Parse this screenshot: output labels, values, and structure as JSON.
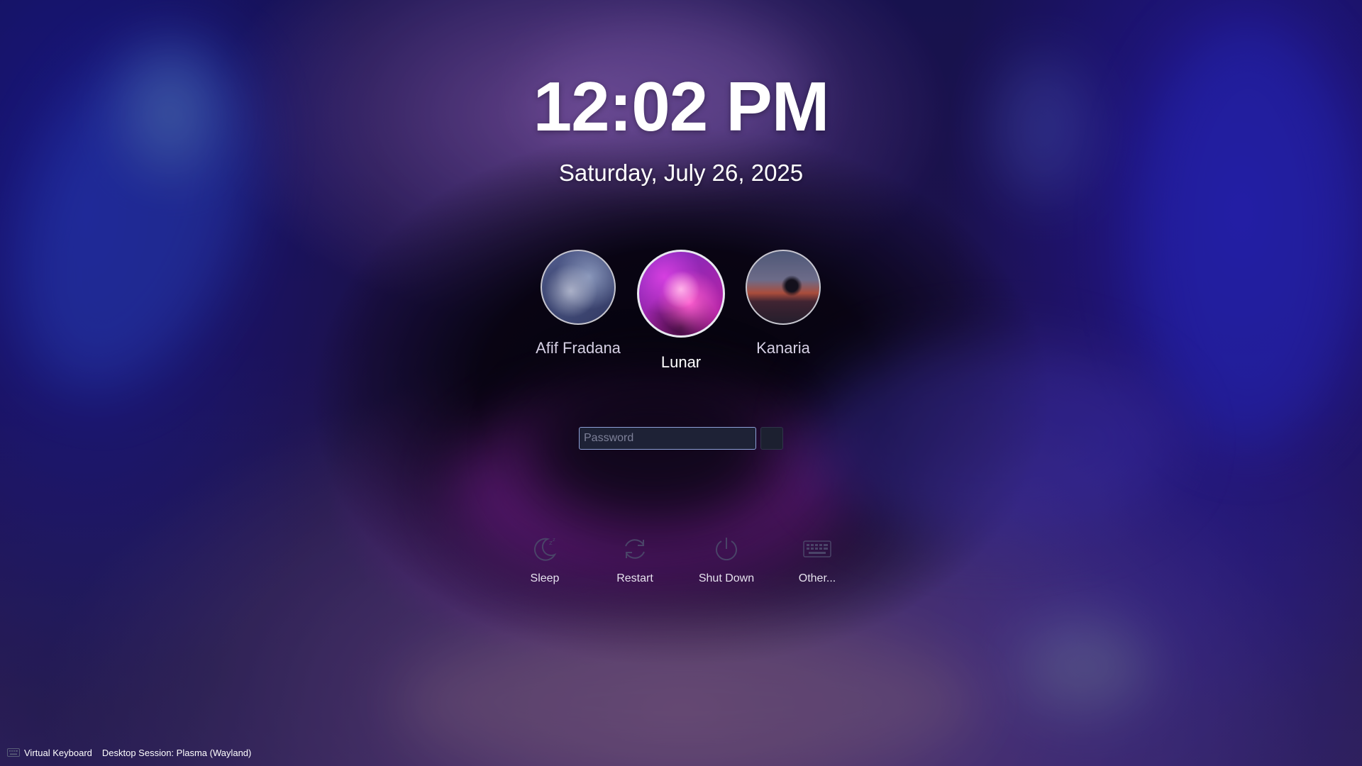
{
  "clock": {
    "time": "12:02 PM",
    "date": "Saturday, July 26, 2025"
  },
  "users": [
    {
      "name": "Afif Fradana",
      "selected": false
    },
    {
      "name": "Lunar",
      "selected": true
    },
    {
      "name": "Kanaria",
      "selected": false
    }
  ],
  "password": {
    "placeholder": "Password",
    "value": ""
  },
  "actions": [
    {
      "label": "Sleep",
      "icon": "sleep-icon"
    },
    {
      "label": "Restart",
      "icon": "restart-icon"
    },
    {
      "label": "Shut Down",
      "icon": "shutdown-icon"
    },
    {
      "label": "Other...",
      "icon": "keyboard-grid-icon"
    }
  ],
  "footer": {
    "virtual_keyboard": "Virtual Keyboard",
    "session": "Desktop Session: Plasma (Wayland)"
  },
  "colors": {
    "accent_border": "#8ea0d8",
    "field_background": "#1e2236",
    "text": "#ffffff"
  }
}
